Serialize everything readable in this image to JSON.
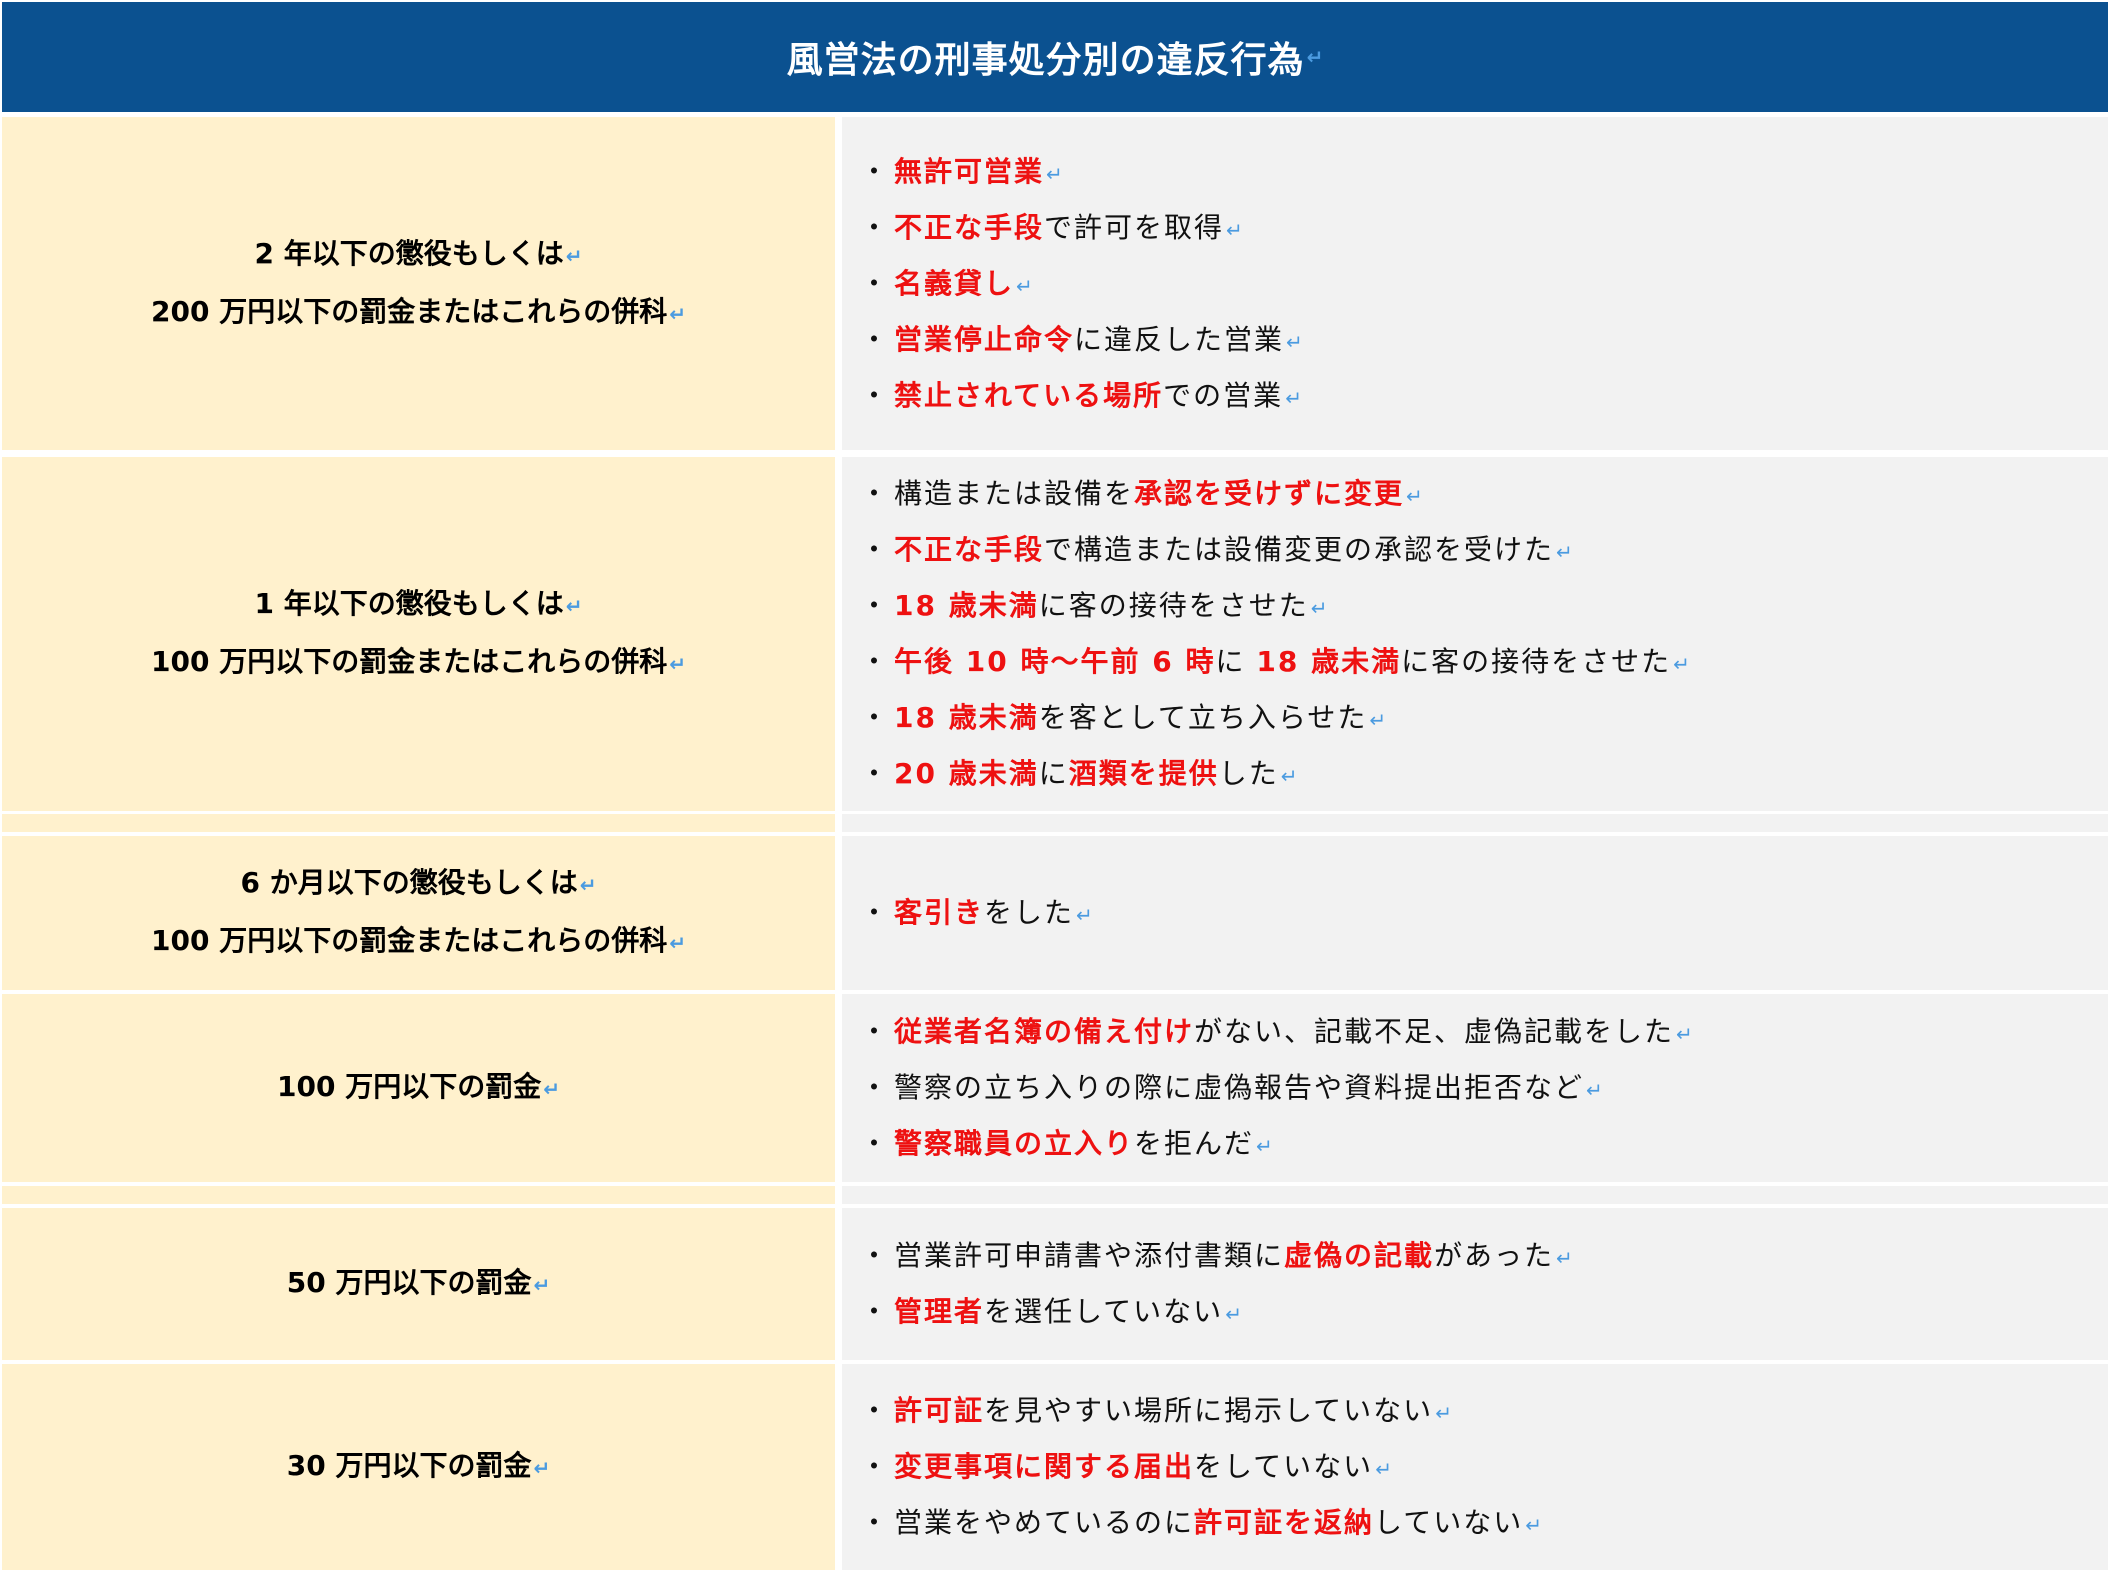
{
  "title": "風営法の刑事処分別の違反行為",
  "return_mark": "↵",
  "bullet": "・",
  "colors": {
    "header_bg": "#0b5190",
    "left_bg": "#fff1cd",
    "right_bg": "#f2f2f2",
    "highlight": "#ee1111",
    "return_mark": "#4b9be0"
  },
  "rows": [
    {
      "penalty": [
        "2 年以下の懲役もしくは",
        "200 万円以下の罰金またはこれらの併科"
      ],
      "items": [
        [
          {
            "t": "無許可営業",
            "r": true
          }
        ],
        [
          {
            "t": "不正な手段",
            "r": true
          },
          {
            "t": "で許可を取得",
            "r": false
          }
        ],
        [
          {
            "t": "名義貸し",
            "r": true
          }
        ],
        [
          {
            "t": "営業停止命令",
            "r": true
          },
          {
            "t": "に違反した営業",
            "r": false
          }
        ],
        [
          {
            "t": "禁止されている場所",
            "r": true
          },
          {
            "t": "での営業",
            "r": false
          }
        ]
      ]
    },
    {
      "penalty": [
        "1 年以下の懲役もしくは",
        "100 万円以下の罰金またはこれらの併科"
      ],
      "items": [
        [
          {
            "t": "構造または設備を",
            "r": false
          },
          {
            "t": "承認を受けずに変更",
            "r": true
          }
        ],
        [
          {
            "t": "不正な手段",
            "r": true
          },
          {
            "t": "で構造または設備変更の承認を受けた",
            "r": false
          }
        ],
        [
          {
            "t": "18 歳未満",
            "r": true
          },
          {
            "t": "に客の接待をさせた",
            "r": false
          }
        ],
        [
          {
            "t": "午後 10 時～午前 6 時",
            "r": true
          },
          {
            "t": "に ",
            "r": false
          },
          {
            "t": "18 歳未満",
            "r": true
          },
          {
            "t": "に客の接待をさせた",
            "r": false
          }
        ],
        [
          {
            "t": "18 歳未満",
            "r": true
          },
          {
            "t": "を客として立ち入らせた",
            "r": false
          }
        ],
        [
          {
            "t": "20 歳未満",
            "r": true
          },
          {
            "t": "に",
            "r": false
          },
          {
            "t": "酒類を提供",
            "r": true
          },
          {
            "t": "した",
            "r": false
          }
        ]
      ]
    },
    {
      "penalty": [
        "6 か月以下の懲役もしくは",
        "100 万円以下の罰金またはこれらの併科"
      ],
      "items": [
        [
          {
            "t": "客引き",
            "r": true
          },
          {
            "t": "をした",
            "r": false
          }
        ]
      ]
    },
    {
      "penalty": [
        "100 万円以下の罰金"
      ],
      "items": [
        [
          {
            "t": "従業者名簿の備え付け",
            "r": true
          },
          {
            "t": "がない、記載不足、虚偽記載をした",
            "r": false
          }
        ],
        [
          {
            "t": "警察の立ち入りの際に虚偽報告や資料提出拒否など",
            "r": false
          }
        ],
        [
          {
            "t": "警察職員の立入り",
            "r": true
          },
          {
            "t": "を拒んだ",
            "r": false
          }
        ]
      ]
    },
    {
      "penalty": [
        "50 万円以下の罰金"
      ],
      "items": [
        [
          {
            "t": "営業許可申請書や添付書類に",
            "r": false
          },
          {
            "t": "虚偽の記載",
            "r": true
          },
          {
            "t": "があった",
            "r": false
          }
        ],
        [
          {
            "t": "管理者",
            "r": true
          },
          {
            "t": "を選任していない",
            "r": false
          }
        ]
      ]
    },
    {
      "penalty": [
        "30 万円以下の罰金"
      ],
      "items": [
        [
          {
            "t": "許可証",
            "r": true
          },
          {
            "t": "を見やすい場所に掲示していない",
            "r": false
          }
        ],
        [
          {
            "t": "変更事項に関する届出",
            "r": true
          },
          {
            "t": "をしていない",
            "r": false
          }
        ],
        [
          {
            "t": "営業をやめているのに",
            "r": false
          },
          {
            "t": "許可証を返納",
            "r": true
          },
          {
            "t": "していない",
            "r": false
          }
        ]
      ]
    }
  ]
}
